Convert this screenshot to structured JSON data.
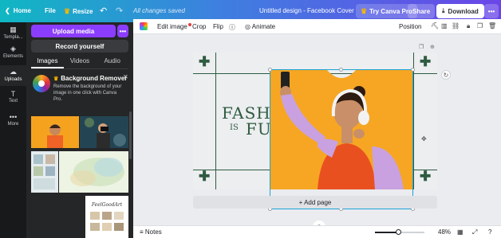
{
  "topbar": {
    "home": "Home",
    "file": "File",
    "resize": "Resize",
    "undo_icon": "undo-icon",
    "redo_icon": "redo-icon",
    "save_status": "All changes saved",
    "doc_title": "Untitled design - Facebook Cover",
    "try_pro": "Try Canva Pro",
    "share": "Share",
    "download": "Download",
    "more": "•••"
  },
  "rail": {
    "items": [
      {
        "label": "Templa...",
        "icon": "template-icon"
      },
      {
        "label": "Elements",
        "icon": "elements-icon"
      },
      {
        "label": "Uploads",
        "icon": "upload-cloud-icon"
      },
      {
        "label": "Text",
        "icon": "text-icon"
      },
      {
        "label": "More",
        "icon": "more-icon"
      }
    ]
  },
  "panel": {
    "upload_media": "Upload media",
    "upload_more": "•••",
    "record": "Record yourself",
    "tabs": [
      "Images",
      "Videos",
      "Audio"
    ],
    "promo": {
      "title": "Background Remover",
      "text": "Remove the background of your image in one click with Canva Pro.",
      "close": "✕"
    },
    "thumb_caption": "FeelGoodArt"
  },
  "context_bar": {
    "edit_image": "Edit image",
    "crop": "Crop",
    "flip": "Flip",
    "info": "ⓘ",
    "animate": "Animate",
    "position": "Position"
  },
  "canvas": {
    "headline_1": "FASHION",
    "headline_2": "IS",
    "headline_3": "FUN",
    "add_page": "+ Add page",
    "accent_color": "#2f5b40",
    "photo_bg_color": "#f6a623"
  },
  "footer": {
    "notes": "Notes",
    "zoom_percent": 48,
    "zoom_label": "48%"
  },
  "colors": {
    "brand_gradient_start": "#10b7c3",
    "brand_gradient_end": "#6a46e8",
    "primary_purple": "#8b3dff",
    "selection_blue": "#1ba3d6"
  }
}
